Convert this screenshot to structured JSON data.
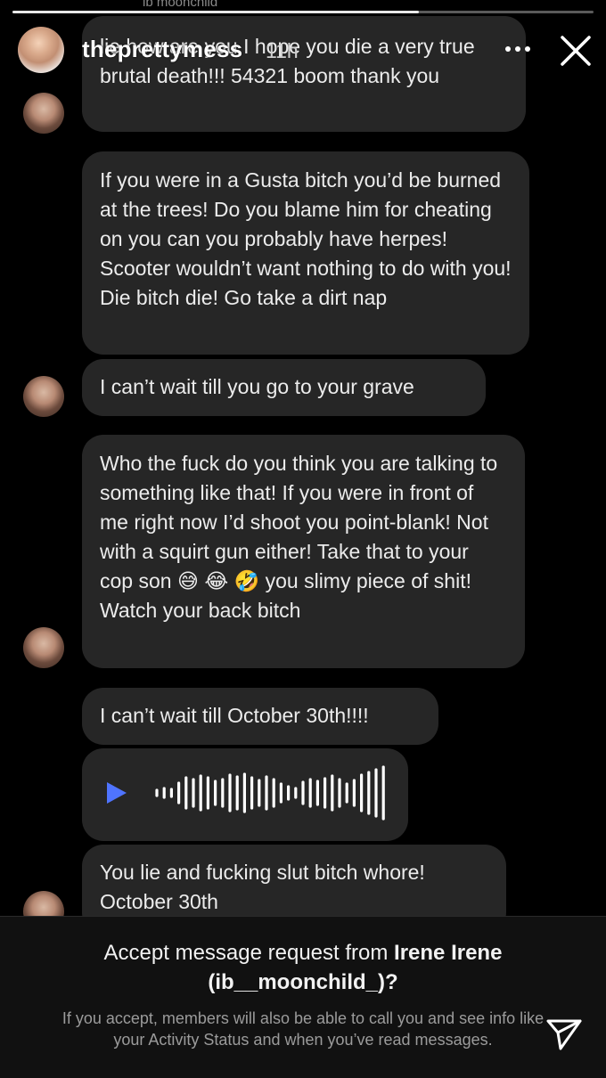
{
  "status": {
    "ghost_text": "ib    moonchild"
  },
  "story": {
    "progress_fraction": 0.7,
    "username": "theprettymess",
    "time": "11h",
    "more_icon": "more-horizontal-icon",
    "close_icon": "close-icon"
  },
  "messages": [
    {
      "text": "lie how are you I hope you die a very true brutal death!!! 54321 boom thank you"
    },
    {
      "text": "If you were in a Gusta bitch you’d be burned at the trees! Do you blame him for cheating on you can you probably have herpes! Scooter   wouldn’t want nothing to do with you! Die bitch die! Go take a dirt nap"
    },
    {
      "text": "I can’t wait till you go to your grave"
    },
    {
      "text": "Who the fuck do you think you are talking to something like that! If you were in front of me right now I’d shoot you point-blank! Not with a squirt gun either! Take that to your cop son 😅 😂 🤣  you slimy piece of shit! Watch your back bitch"
    },
    {
      "text": "I can’t wait till October 30th!!!!"
    },
    {
      "type": "audio",
      "play_icon": "play-icon"
    },
    {
      "text": "You lie and fucking slut bitch whore! October 30th"
    }
  ],
  "request": {
    "prefix": "Accept message request from ",
    "name": "Irene Irene",
    "handle": "(ib__moonchild_)?",
    "info_line1": "If you accept, members will also be able to call you and see info like",
    "info_line2": "your Activity Status and when you’ve read messages.",
    "send_icon": "send-icon"
  },
  "colors": {
    "bubble": "#262626",
    "play": "#4f74ff",
    "background": "#000000"
  }
}
